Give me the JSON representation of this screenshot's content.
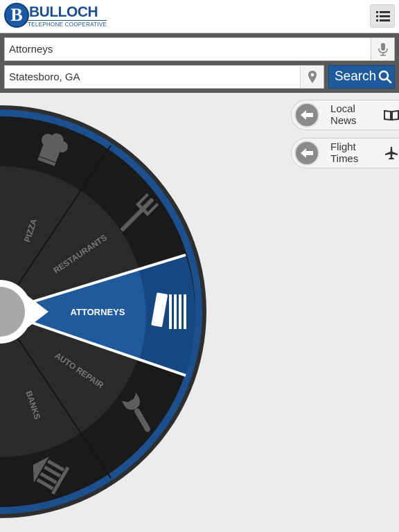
{
  "header": {
    "logo_letter": "B",
    "logo_name": "BULLOCH",
    "logo_sub": "TELEPHONE COOPERATIVE",
    "menu_icon": "list-icon"
  },
  "search": {
    "what_value": "Attorneys",
    "where_value": "Statesboro, GA",
    "button_label": "Search",
    "mic_icon": "microphone-icon",
    "location_icon": "location-pin-icon",
    "search_icon": "magnifier-icon"
  },
  "wheel": {
    "selected": "ATTORNEYS",
    "categories": [
      "PIZZA",
      "RESTAURANTS",
      "ATTORNEYS",
      "AUTO REPAIR",
      "BANKS"
    ]
  },
  "side_tabs": [
    {
      "label": "Local News",
      "icon": "open-book-icon"
    },
    {
      "label": "Flight Times",
      "icon": "airplane-icon"
    }
  ],
  "colors": {
    "brand_blue": "#1f5a9c",
    "wheel_dark": "#1e1e1e",
    "wheel_ring": "#1b4f8e",
    "selected_slice": "#1f5a9c"
  }
}
